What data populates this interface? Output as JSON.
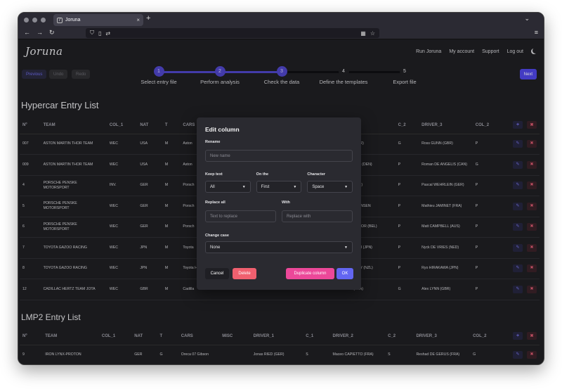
{
  "browser": {
    "tab_title": "Joruna",
    "new_tab": "+",
    "tab_close": "×",
    "back": "←",
    "forward": "→",
    "reload": "↻",
    "menu": "≡",
    "chevron": "⌄"
  },
  "app": {
    "logo": "Joruna",
    "nav": [
      "Run Joruna",
      "My account",
      "Support",
      "Log out"
    ],
    "buttons": {
      "previous": "Previous",
      "undo": "Undo",
      "redo": "Redo",
      "next": "Next"
    }
  },
  "stepper": {
    "steps": [
      {
        "num": "1",
        "label": "Select entry file",
        "status": "done"
      },
      {
        "num": "2",
        "label": "Perform analysis",
        "status": "done"
      },
      {
        "num": "3",
        "label": "Check the data",
        "status": "done"
      },
      {
        "num": "4",
        "label": "Define the templates",
        "status": "todo"
      },
      {
        "num": "5",
        "label": "Export file",
        "status": "todo"
      }
    ]
  },
  "hypercar": {
    "title": "Hypercar Entry List",
    "headers": [
      "Nº",
      "TEAM",
      "COL_1",
      "NAT",
      "T",
      "CARS",
      "",
      "",
      "",
      "C_2",
      "DRIVER_3",
      "COL_2"
    ],
    "rows": [
      {
        "num": "007",
        "team": "ASTON MARTIN THOR TEAM",
        "col1": "WEC",
        "nat": "USA",
        "t": "M",
        "car": "Aston",
        "d2": "(GBR)",
        "c2": "G",
        "d3": "Ross GUNN (GBR)",
        "col2": "P"
      },
      {
        "num": "009",
        "team": "ASTON MARTIN THOR TEAM",
        "col1": "WEC",
        "nat": "USA",
        "t": "M",
        "car": "Aston",
        "d2": "SEN (DEN)",
        "c2": "P",
        "d3": "Roman DE ANGELIS (CAN)",
        "col2": "G"
      },
      {
        "num": "4",
        "team": "PORSCHE PENSKE MOTORSPORT",
        "col1": "INV.",
        "nat": "GER",
        "t": "M",
        "car": "Porsch",
        "d2": "GBR)",
        "c2": "P",
        "d3": "Pascal WEHRLEIN (GER)",
        "col2": "P"
      },
      {
        "num": "5",
        "team": "PORSCHE PENSKE MOTORSPORT",
        "col1": "WEC",
        "nat": "GER",
        "t": "M",
        "car": "Porsch",
        "d2": "STENSEN",
        "c2": "P",
        "d3": "Mathieu JAMINET (FRA)",
        "col2": "P"
      },
      {
        "num": "6",
        "team": "PORSCHE PENSKE MOTORSPORT",
        "col1": "WEC",
        "nat": "GER",
        "t": "M",
        "car": "Porsch",
        "d2": "THOOR (BEL)",
        "c2": "P",
        "d3": "Matt CAMPBELL (AUS)",
        "col2": "P"
      },
      {
        "num": "7",
        "team": "TOYOTA GAZOO RACING",
        "col1": "WEC",
        "nat": "JPN",
        "t": "M",
        "car": "Toyota",
        "d2": "ASHI (JPN)",
        "c2": "P",
        "d3": "Nyck DE VRIES (NED)",
        "col2": "P"
      },
      {
        "num": "8",
        "team": "TOYOTA GAZOO RACING",
        "col1": "WEC",
        "nat": "JPN",
        "t": "M",
        "car": "Toyota Hybrid",
        "d2": "TLEY (NZL)",
        "c2": "P",
        "d3": "Ryo HIRAKAWA (JPN)",
        "col2": "P"
      },
      {
        "num": "12",
        "team": "CADILLAC HERTZ TEAM JOTA",
        "col1": "WEC",
        "nat": "GBR",
        "t": "M",
        "car": "Cadilla",
        "d2": "(FRA)",
        "c2": "G",
        "d3": "Alex LYNN (GBR)",
        "col2": "P"
      }
    ]
  },
  "lmp2": {
    "title": "LMP2 Entry List",
    "headers": [
      "Nº",
      "TEAM",
      "COL_1",
      "NAT",
      "T",
      "CARS",
      "MISC",
      "DRIVER_1",
      "C_1",
      "DRIVER_2",
      "C_2",
      "DRIVER_3",
      "COL_2"
    ],
    "rows": [
      {
        "num": "9",
        "team": "IRON LYNX-PROTON",
        "col1": "",
        "nat": "GER",
        "t": "G",
        "car": "Oreca 07 Gibson",
        "misc": "",
        "d1": "Jonas RIED (GER)",
        "c1": "S",
        "d2": "Maceo CAPIETTO (FRA)",
        "c2": "S",
        "d3": "Reshad DE GERUS (FRA)",
        "col2": "G"
      }
    ]
  },
  "modal": {
    "title": "Edit column",
    "rename_label": "Rename",
    "rename_placeholder": "New name",
    "keep_text_label": "Keep text",
    "keep_text_value": "All",
    "on_the_label": "On the",
    "on_the_value": "First",
    "character_label": "Character",
    "character_value": "Space",
    "replace_all_label": "Replace all",
    "replace_placeholder": "Text to replace",
    "with_label": "With",
    "with_placeholder": "Replace with",
    "change_case_label": "Change case",
    "change_case_value": "None",
    "buttons": {
      "cancel": "Cancel",
      "delete": "Delete",
      "duplicate": "Duplicate column",
      "ok": "OK"
    }
  }
}
